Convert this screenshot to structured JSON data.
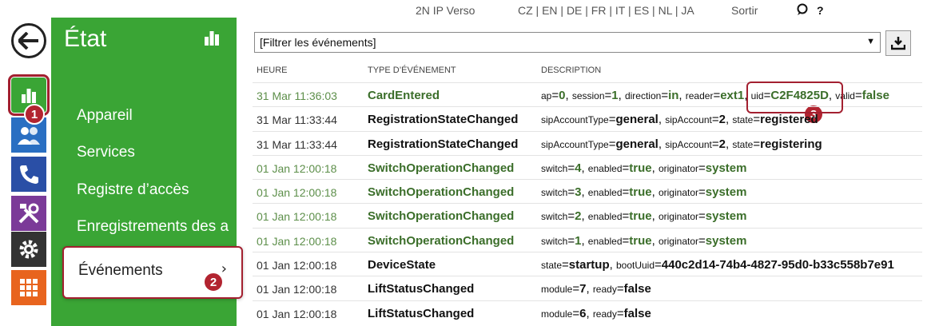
{
  "topbar": {
    "product": "2N IP Verso",
    "languages": "CZ | EN | DE | FR | IT | ES | NL | JA",
    "logout": "Sortir",
    "help": "?"
  },
  "sidebar_icons": [
    "back-arrow-icon",
    "bar-chart-icon",
    "users-icon",
    "phone-icon",
    "tools-icon",
    "gear-icon",
    "grid-icon"
  ],
  "badges": {
    "b1": "1",
    "b2": "2",
    "b3": "3"
  },
  "menu": {
    "title": "État",
    "items": [
      {
        "label": "Appareil"
      },
      {
        "label": "Services"
      },
      {
        "label": "Registre d’accès"
      },
      {
        "label": "Enregistrements des a"
      }
    ],
    "active": {
      "label": "Événements",
      "chevron": "›"
    }
  },
  "filter": {
    "label": "[Filtrer les événements]"
  },
  "table": {
    "headers": [
      "HEURE",
      "TYPE D’ÉVÉNEMENT",
      "DESCRIPTION"
    ],
    "rows": [
      {
        "time": "31 Mar 11:36:03",
        "type": "CardEntered",
        "desc": [
          [
            "ap",
            "0"
          ],
          [
            "session",
            "1"
          ],
          [
            "direction",
            "in"
          ],
          [
            "reader",
            "ext1"
          ],
          [
            "uid",
            "C2F4825D"
          ],
          [
            "valid",
            "false"
          ]
        ]
      },
      {
        "time": "31 Mar 11:33:44",
        "type": "RegistrationStateChanged",
        "desc": [
          [
            "sipAccountType",
            "general"
          ],
          [
            "sipAccount",
            "2"
          ],
          [
            "state",
            "registered"
          ]
        ]
      },
      {
        "time": "31 Mar 11:33:44",
        "type": "RegistrationStateChanged",
        "desc": [
          [
            "sipAccountType",
            "general"
          ],
          [
            "sipAccount",
            "2"
          ],
          [
            "state",
            "registering"
          ]
        ]
      },
      {
        "time": "01 Jan 12:00:18",
        "type": "SwitchOperationChanged",
        "desc": [
          [
            "switch",
            "4"
          ],
          [
            "enabled",
            "true"
          ],
          [
            "originator",
            "system"
          ]
        ]
      },
      {
        "time": "01 Jan 12:00:18",
        "type": "SwitchOperationChanged",
        "desc": [
          [
            "switch",
            "3"
          ],
          [
            "enabled",
            "true"
          ],
          [
            "originator",
            "system"
          ]
        ]
      },
      {
        "time": "01 Jan 12:00:18",
        "type": "SwitchOperationChanged",
        "desc": [
          [
            "switch",
            "2"
          ],
          [
            "enabled",
            "true"
          ],
          [
            "originator",
            "system"
          ]
        ]
      },
      {
        "time": "01 Jan 12:00:18",
        "type": "SwitchOperationChanged",
        "desc": [
          [
            "switch",
            "1"
          ],
          [
            "enabled",
            "true"
          ],
          [
            "originator",
            "system"
          ]
        ]
      },
      {
        "time": "01 Jan 12:00:18",
        "type": "DeviceState",
        "desc": [
          [
            "state",
            "startup"
          ],
          [
            "bootUuid",
            "440c2d14-74b4-4827-95d0-b33c558b7e91"
          ]
        ]
      },
      {
        "time": "01 Jan 12:00:18",
        "type": "LiftStatusChanged",
        "desc": [
          [
            "module",
            "7"
          ],
          [
            "ready",
            "false"
          ]
        ]
      },
      {
        "time": "01 Jan 12:00:18",
        "type": "LiftStatusChanged",
        "desc": [
          [
            "module",
            "6"
          ],
          [
            "ready",
            "false"
          ]
        ]
      }
    ]
  },
  "colors": {
    "green": "#3aa535",
    "annotation": "#a32030",
    "darkgreen": "#3b6e2a"
  }
}
